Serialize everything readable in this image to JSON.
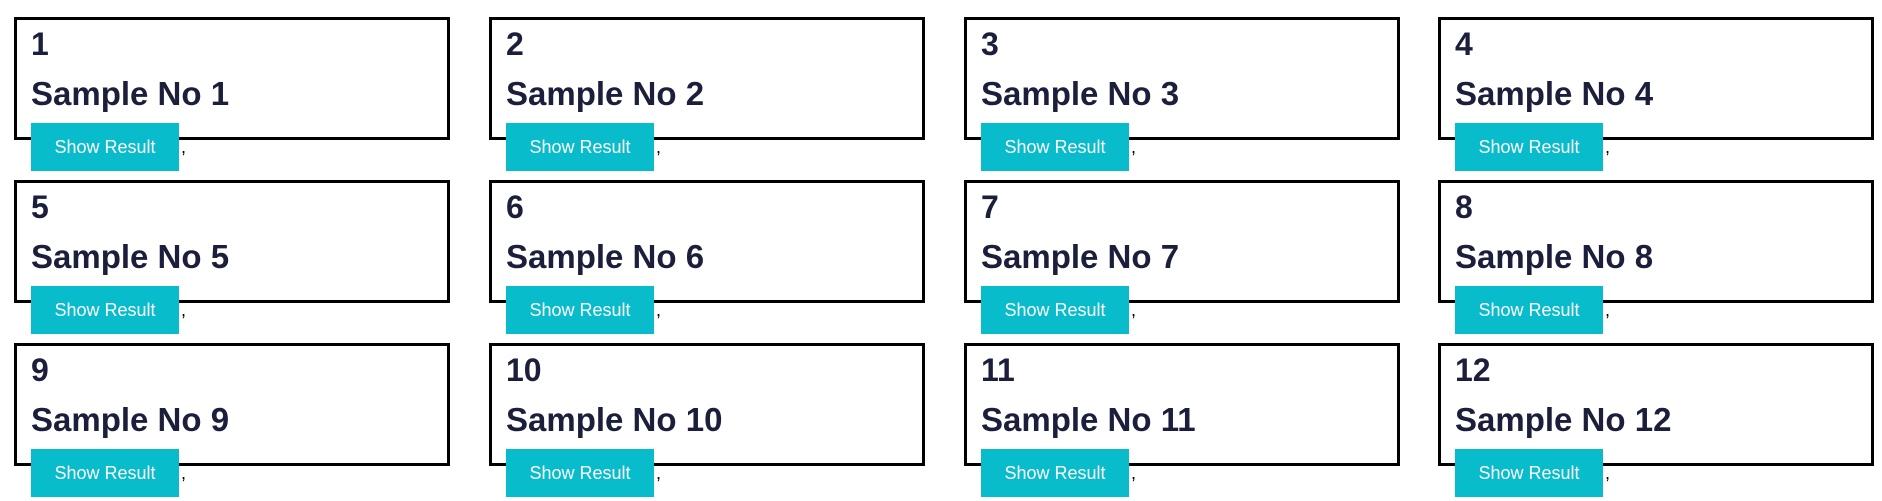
{
  "samples": [
    {
      "number": "1",
      "title": "Sample No 1",
      "button_label": "Show Result",
      "separator": ","
    },
    {
      "number": "2",
      "title": "Sample No 2",
      "button_label": "Show Result",
      "separator": ","
    },
    {
      "number": "3",
      "title": "Sample No 3",
      "button_label": "Show Result",
      "separator": ","
    },
    {
      "number": "4",
      "title": "Sample No 4",
      "button_label": "Show Result",
      "separator": ","
    },
    {
      "number": "5",
      "title": "Sample No 5",
      "button_label": "Show Result",
      "separator": ","
    },
    {
      "number": "6",
      "title": "Sample No 6",
      "button_label": "Show Result",
      "separator": ","
    },
    {
      "number": "7",
      "title": "Sample No 7",
      "button_label": "Show Result",
      "separator": ","
    },
    {
      "number": "8",
      "title": "Sample No 8",
      "button_label": "Show Result",
      "separator": ","
    },
    {
      "number": "9",
      "title": "Sample No 9",
      "button_label": "Show Result",
      "separator": ","
    },
    {
      "number": "10",
      "title": "Sample No 10",
      "button_label": "Show Result",
      "separator": ","
    },
    {
      "number": "11",
      "title": "Sample No 11",
      "button_label": "Show Result",
      "separator": ","
    },
    {
      "number": "12",
      "title": "Sample No 12",
      "button_label": "Show Result",
      "separator": ","
    }
  ],
  "colors": {
    "button_bg": "#08bccc",
    "button_text": "#ffffff",
    "heading_text": "#1b1f3b",
    "card_border": "#000000"
  }
}
